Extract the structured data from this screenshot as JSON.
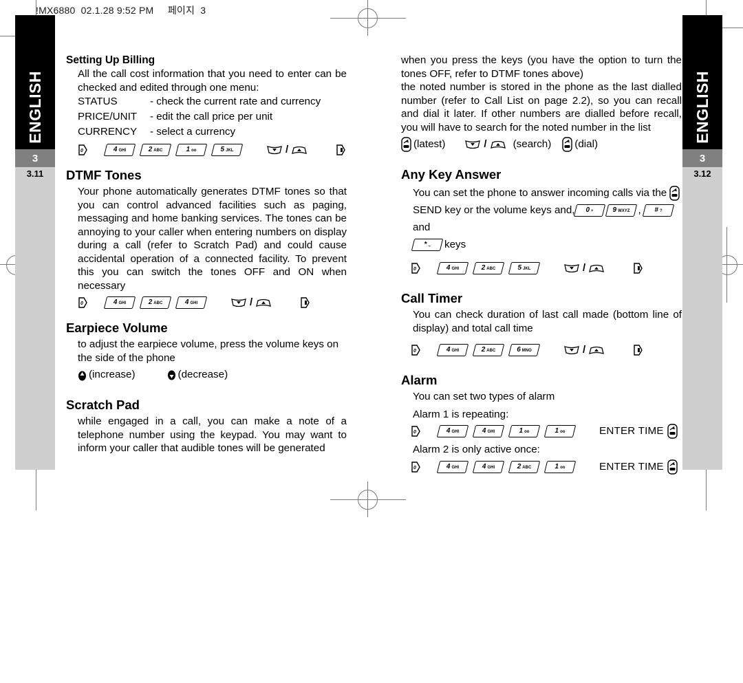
{
  "header": {
    "text": "!MX6880  02.1.28 9:52 PM",
    "korean_page_label": "페이지",
    "page_number": "3"
  },
  "side_tabs": {
    "left": {
      "language": "ENGLISH",
      "chapter": "3",
      "section": "3.11"
    },
    "right": {
      "language": "ENGLISH",
      "chapter": "3",
      "section": "3.12"
    }
  },
  "left_column": {
    "billing": {
      "heading": "Setting Up Billing",
      "body": "All the call cost information that you need to enter can be checked and edited through one menu:",
      "menu_items": [
        {
          "name": "STATUS",
          "desc": "- check the current rate and currency"
        },
        {
          "name": "PRICE/UNIT",
          "desc": "- edit the call price per unit"
        },
        {
          "name": "CURRENCY",
          "desc": "- select a currency"
        }
      ],
      "keys": [
        {
          "type": "menu"
        },
        {
          "type": "num",
          "digit": "4",
          "alpha": "GHI"
        },
        {
          "type": "num",
          "digit": "2",
          "alpha": "ABC"
        },
        {
          "type": "num",
          "digit": "1",
          "alpha": ""
        },
        {
          "type": "num",
          "digit": "5",
          "alpha": "JKL"
        },
        {
          "type": "scroll"
        },
        {
          "type": "end"
        }
      ]
    },
    "dtmf": {
      "heading": "DTMF Tones",
      "body": "Your phone automatically generates DTMF tones so that you can control advanced facilities such as paging, messaging and home banking services. The tones can be annoying to your caller when entering numbers on display during a call (refer to Scratch Pad) and could cause accidental operation of a connected facility. To prevent this you can switch the tones OFF and ON when necessary",
      "keys": [
        {
          "type": "menu"
        },
        {
          "type": "num",
          "digit": "4",
          "alpha": "GHI"
        },
        {
          "type": "num",
          "digit": "2",
          "alpha": "ABC"
        },
        {
          "type": "num",
          "digit": "4",
          "alpha": "GHI"
        },
        {
          "type": "scroll"
        },
        {
          "type": "end"
        }
      ]
    },
    "earpiece": {
      "heading": "Earpiece Volume",
      "body": "to adjust the earpiece volume, press the volume keys on the side of the phone",
      "increase_label": "(increase)",
      "decrease_label": "(decrease)"
    },
    "scratch": {
      "heading": "Scratch Pad",
      "body": "while engaged in a call, you can make a note of a telephone number using the keypad. You may want to inform your caller that audible tones will be generated"
    }
  },
  "right_column": {
    "scratch_cont": {
      "para1": "when you press the keys (you have the option to turn the tones OFF, refer to DTMF tones above)",
      "para2": "the noted number is stored in the phone as the last dialled number (refer to Call List on page 2.2), so you can recall and dial it later. If other numbers are dialled before recall, you will have to search for the noted number in the list",
      "latest_label": "(latest)",
      "search_label": "(search)",
      "dial_label": "(dial)"
    },
    "any_key": {
      "heading": "Any Key Answer",
      "text_part1": "You can set the phone to answer incoming calls via the",
      "text_part2": "SEND key or the volume keys and,",
      "text_comma": ",",
      "text_and": "and",
      "text_keys": "keys",
      "inline_keys": [
        {
          "digit": "0",
          "alpha": "+"
        },
        {
          "digit": "9",
          "alpha": "WXYZ"
        },
        {
          "digit": "#",
          "alpha": "?"
        },
        {
          "digit": "*",
          "alpha": ".,"
        }
      ],
      "keys": [
        {
          "type": "menu"
        },
        {
          "type": "num",
          "digit": "4",
          "alpha": "GHI"
        },
        {
          "type": "num",
          "digit": "2",
          "alpha": "ABC"
        },
        {
          "type": "num",
          "digit": "5",
          "alpha": "JKL"
        },
        {
          "type": "scroll"
        },
        {
          "type": "end"
        }
      ]
    },
    "call_timer": {
      "heading": "Call Timer",
      "body": "You can check duration of last call made (bottom line of display) and total call time",
      "keys": [
        {
          "type": "menu"
        },
        {
          "type": "num",
          "digit": "4",
          "alpha": "GHI"
        },
        {
          "type": "num",
          "digit": "2",
          "alpha": "ABC"
        },
        {
          "type": "num",
          "digit": "6",
          "alpha": "MNO"
        },
        {
          "type": "scroll"
        },
        {
          "type": "end"
        }
      ]
    },
    "alarm": {
      "heading": "Alarm",
      "body": "You can set two types of alarm",
      "alarm1_label": "Alarm 1 is repeating:",
      "alarm1_keys": [
        {
          "type": "menu"
        },
        {
          "type": "num",
          "digit": "4",
          "alpha": "GHI"
        },
        {
          "type": "num",
          "digit": "4",
          "alpha": "GHI"
        },
        {
          "type": "num",
          "digit": "1",
          "alpha": ""
        },
        {
          "type": "num",
          "digit": "1",
          "alpha": ""
        }
      ],
      "alarm1_action": "ENTER TIME",
      "alarm2_label": "Alarm 2 is only active once:",
      "alarm2_keys": [
        {
          "type": "menu"
        },
        {
          "type": "num",
          "digit": "4",
          "alpha": "GHI"
        },
        {
          "type": "num",
          "digit": "4",
          "alpha": "GHI"
        },
        {
          "type": "num",
          "digit": "2",
          "alpha": "ABC"
        },
        {
          "type": "num",
          "digit": "1",
          "alpha": ""
        }
      ],
      "alarm2_action": "ENTER TIME"
    }
  },
  "colors": {
    "tab_black": "#000000",
    "tab_grey": "#808080",
    "tab_light": "#cfcfcf",
    "regmark": "#7a7a7a"
  }
}
